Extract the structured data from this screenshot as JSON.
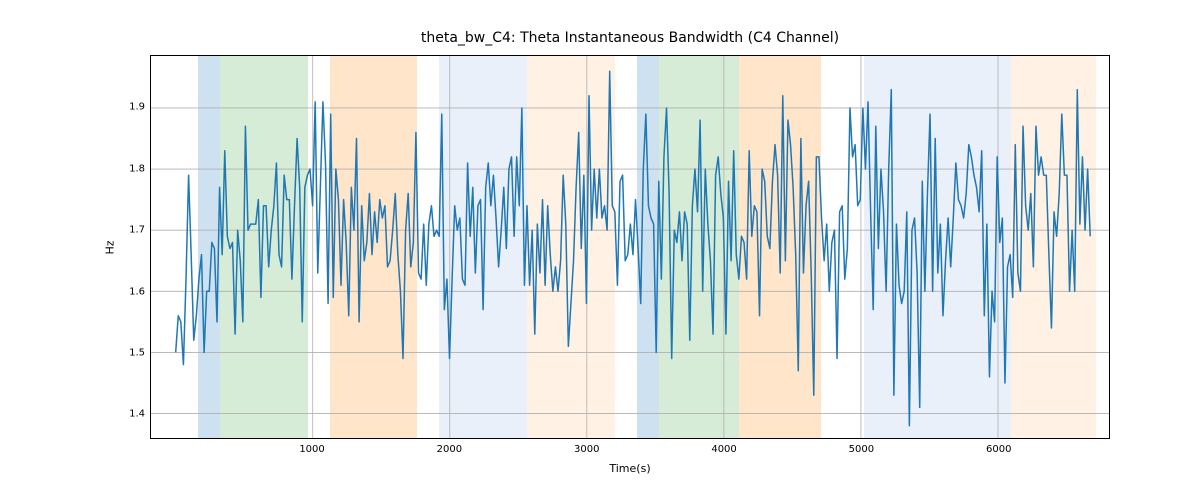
{
  "chart_data": {
    "type": "line",
    "title": "theta_bw_C4: Theta Instantaneous Bandwidth (C4 Channel)",
    "xlabel": "Time(s)",
    "ylabel": "Hz",
    "xlim": [
      -180,
      6810
    ],
    "ylim": [
      1.36,
      1.985
    ],
    "x_ticks": [
      1000,
      2000,
      3000,
      4000,
      5000,
      6000
    ],
    "y_ticks": [
      1.4,
      1.5,
      1.6,
      1.7,
      1.8,
      1.9
    ],
    "background_spans": [
      {
        "x0": 160,
        "x1": 320,
        "color": "#a6c8e4",
        "alpha": 0.55
      },
      {
        "x0": 320,
        "x1": 960,
        "color": "#b4ddb4",
        "alpha": 0.55
      },
      {
        "x0": 1120,
        "x1": 1760,
        "color": "#ffcf9e",
        "alpha": 0.55
      },
      {
        "x0": 1920,
        "x1": 2080,
        "color": "#d7e3f4",
        "alpha": 0.55
      },
      {
        "x0": 2080,
        "x1": 2560,
        "color": "#d7e3f4",
        "alpha": 0.55
      },
      {
        "x0": 2560,
        "x1": 3200,
        "color": "#ffe6cc",
        "alpha": 0.55
      },
      {
        "x0": 3360,
        "x1": 3520,
        "color": "#a6c8e4",
        "alpha": 0.55
      },
      {
        "x0": 3520,
        "x1": 4100,
        "color": "#b4ddb4",
        "alpha": 0.55
      },
      {
        "x0": 4100,
        "x1": 4700,
        "color": "#ffcf9e",
        "alpha": 0.55
      },
      {
        "x0": 5010,
        "x1": 6080,
        "color": "#d7e3f4",
        "alpha": 0.55
      },
      {
        "x0": 6080,
        "x1": 6700,
        "color": "#ffe6cc",
        "alpha": 0.55
      }
    ],
    "series_y": [
      1.5,
      1.56,
      1.55,
      1.48,
      1.62,
      1.79,
      1.66,
      1.52,
      1.56,
      1.62,
      1.66,
      1.5,
      1.6,
      1.6,
      1.68,
      1.67,
      1.55,
      1.77,
      1.66,
      1.83,
      1.69,
      1.67,
      1.68,
      1.53,
      1.7,
      1.65,
      1.55,
      1.87,
      1.7,
      1.71,
      1.71,
      1.71,
      1.75,
      1.59,
      1.74,
      1.74,
      1.64,
      1.7,
      1.74,
      1.81,
      1.66,
      1.64,
      1.79,
      1.75,
      1.75,
      1.62,
      1.74,
      1.85,
      1.77,
      1.55,
      1.77,
      1.79,
      1.8,
      1.74,
      1.91,
      1.63,
      1.77,
      1.91,
      1.81,
      1.58,
      1.89,
      1.59,
      1.8,
      1.75,
      1.61,
      1.75,
      1.68,
      1.56,
      1.77,
      1.7,
      1.85,
      1.55,
      1.74,
      1.65,
      1.68,
      1.76,
      1.66,
      1.73,
      1.68,
      1.75,
      1.72,
      1.74,
      1.64,
      1.65,
      1.7,
      1.76,
      1.66,
      1.6,
      1.49,
      1.7,
      1.76,
      1.64,
      1.68,
      1.86,
      1.63,
      1.62,
      1.71,
      1.61,
      1.71,
      1.74,
      1.69,
      1.7,
      1.69,
      1.89,
      1.57,
      1.62,
      1.49,
      1.62,
      1.74,
      1.7,
      1.72,
      1.62,
      1.61,
      1.81,
      1.69,
      1.77,
      1.63,
      1.74,
      1.75,
      1.57,
      1.77,
      1.81,
      1.74,
      1.79,
      1.72,
      1.64,
      1.7,
      1.77,
      1.67,
      1.8,
      1.82,
      1.69,
      1.82,
      1.74,
      1.9,
      1.61,
      1.74,
      1.61,
      1.7,
      1.53,
      1.71,
      1.63,
      1.75,
      1.61,
      1.74,
      1.66,
      1.6,
      1.64,
      1.6,
      1.65,
      1.79,
      1.71,
      1.51,
      1.58,
      1.65,
      1.77,
      1.86,
      1.67,
      1.79,
      1.58,
      1.92,
      1.7,
      1.8,
      1.72,
      1.8,
      1.72,
      1.74,
      1.7,
      1.96,
      1.74,
      1.73,
      1.61,
      1.78,
      1.79,
      1.65,
      1.66,
      1.71,
      1.66,
      1.75,
      1.67,
      1.58,
      1.8,
      1.89,
      1.74,
      1.72,
      1.71,
      1.5,
      1.78,
      1.62,
      1.82,
      1.9,
      1.76,
      1.49,
      1.7,
      1.68,
      1.73,
      1.65,
      1.73,
      1.71,
      1.52,
      1.74,
      1.8,
      1.73,
      1.88,
      1.6,
      1.8,
      1.71,
      1.65,
      1.53,
      1.79,
      1.82,
      1.76,
      1.72,
      1.53,
      1.78,
      1.65,
      1.83,
      1.66,
      1.62,
      1.69,
      1.68,
      1.62,
      1.83,
      1.69,
      1.74,
      1.73,
      1.56,
      1.8,
      1.78,
      1.69,
      1.67,
      1.78,
      1.84,
      1.79,
      1.63,
      1.92,
      1.65,
      1.88,
      1.84,
      1.77,
      1.66,
      1.47,
      1.85,
      1.63,
      1.74,
      1.78,
      1.63,
      1.43,
      1.82,
      1.82,
      1.72,
      1.65,
      1.71,
      1.6,
      1.68,
      1.7,
      1.49,
      1.73,
      1.74,
      1.62,
      1.67,
      1.9,
      1.82,
      1.84,
      1.74,
      1.75,
      1.9,
      1.8,
      1.91,
      1.73,
      1.57,
      1.87,
      1.67,
      1.8,
      1.73,
      1.6,
      1.8,
      1.93,
      1.43,
      1.71,
      1.61,
      1.58,
      1.6,
      1.73,
      1.38,
      1.7,
      1.72,
      1.63,
      1.41,
      1.78,
      1.6,
      1.76,
      1.89,
      1.6,
      1.85,
      1.63,
      1.71,
      1.56,
      1.65,
      1.72,
      1.64,
      1.72,
      1.81,
      1.75,
      1.74,
      1.72,
      1.76,
      1.84,
      1.82,
      1.79,
      1.77,
      1.73,
      1.83,
      1.56,
      1.71,
      1.46,
      1.6,
      1.55,
      1.82,
      1.68,
      1.72,
      1.45,
      1.64,
      1.66,
      1.59,
      1.84,
      1.63,
      1.6,
      1.87,
      1.74,
      1.7,
      1.76,
      1.64,
      1.87,
      1.79,
      1.82,
      1.79,
      1.79,
      1.66,
      1.54,
      1.73,
      1.69,
      1.76,
      1.89,
      1.79,
      1.79,
      1.6,
      1.7,
      1.6,
      1.93,
      1.71,
      1.82,
      1.7,
      1.8,
      1.69
    ],
    "series_dx": 18.85,
    "series_x0": 0
  }
}
